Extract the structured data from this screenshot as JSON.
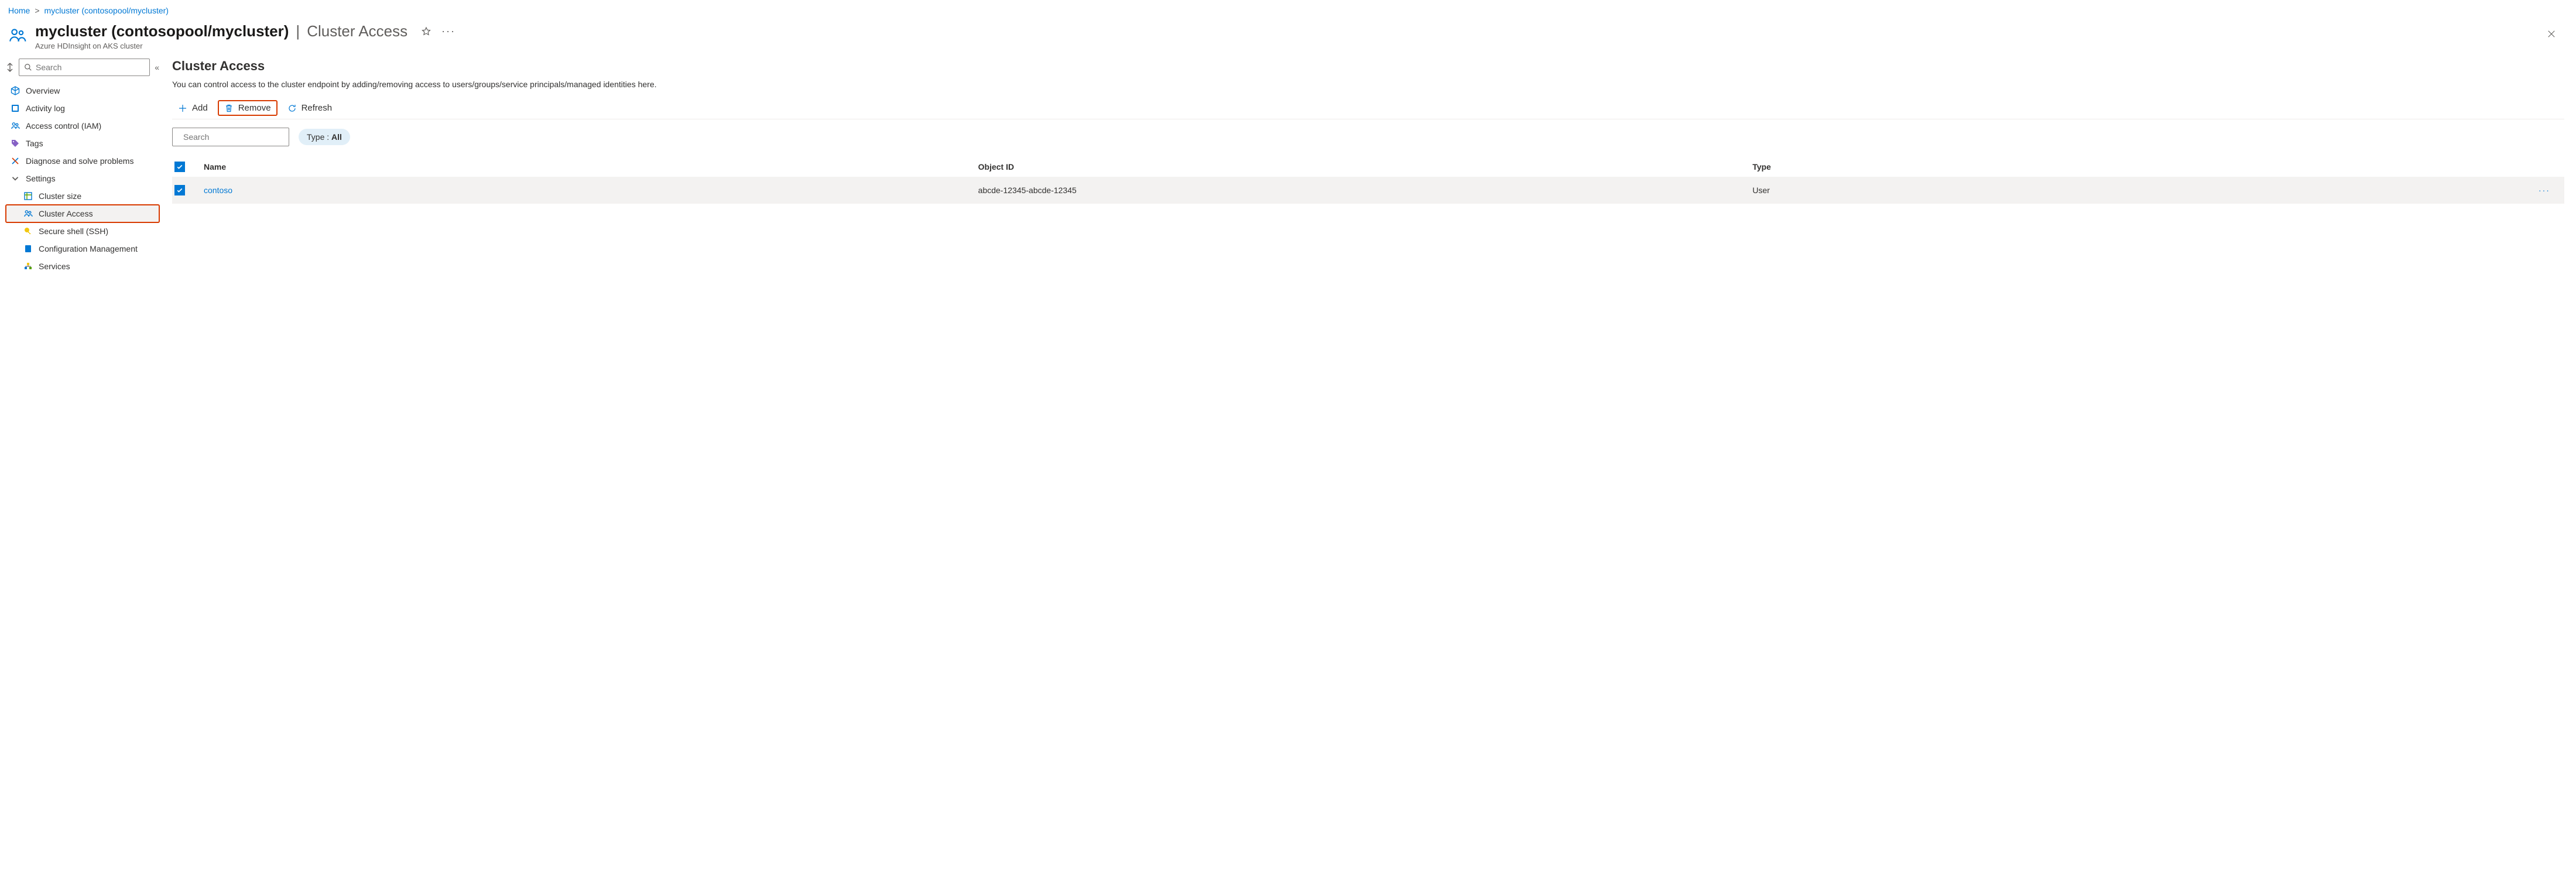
{
  "breadcrumb": {
    "home": "Home",
    "cluster": "mycluster (contosopool/mycluster)"
  },
  "header": {
    "title": "mycluster (contosopool/mycluster)",
    "separator": "|",
    "section": "Cluster Access",
    "subtitle": "Azure HDInsight on AKS cluster"
  },
  "sidebar": {
    "search_placeholder": "Search",
    "items": {
      "overview": "Overview",
      "activity_log": "Activity log",
      "access_control": "Access control (IAM)",
      "tags": "Tags",
      "diagnose": "Diagnose and solve problems",
      "settings_group": "Settings",
      "cluster_size": "Cluster size",
      "cluster_access": "Cluster Access",
      "secure_shell": "Secure shell (SSH)",
      "config_mgmt": "Configuration Management",
      "services": "Services"
    }
  },
  "main": {
    "heading": "Cluster Access",
    "description": "You can control access to the cluster endpoint by adding/removing access to users/groups/service principals/managed identities here.",
    "toolbar": {
      "add": "Add",
      "remove": "Remove",
      "refresh": "Refresh"
    },
    "filter": {
      "search_placeholder": "Search",
      "type_label": "Type :",
      "type_value": "All"
    },
    "table": {
      "columns": {
        "name": "Name",
        "object_id": "Object ID",
        "type": "Type"
      },
      "rows": [
        {
          "name": "contoso",
          "object_id": "abcde-12345-abcde-12345",
          "type": "User"
        }
      ]
    }
  }
}
